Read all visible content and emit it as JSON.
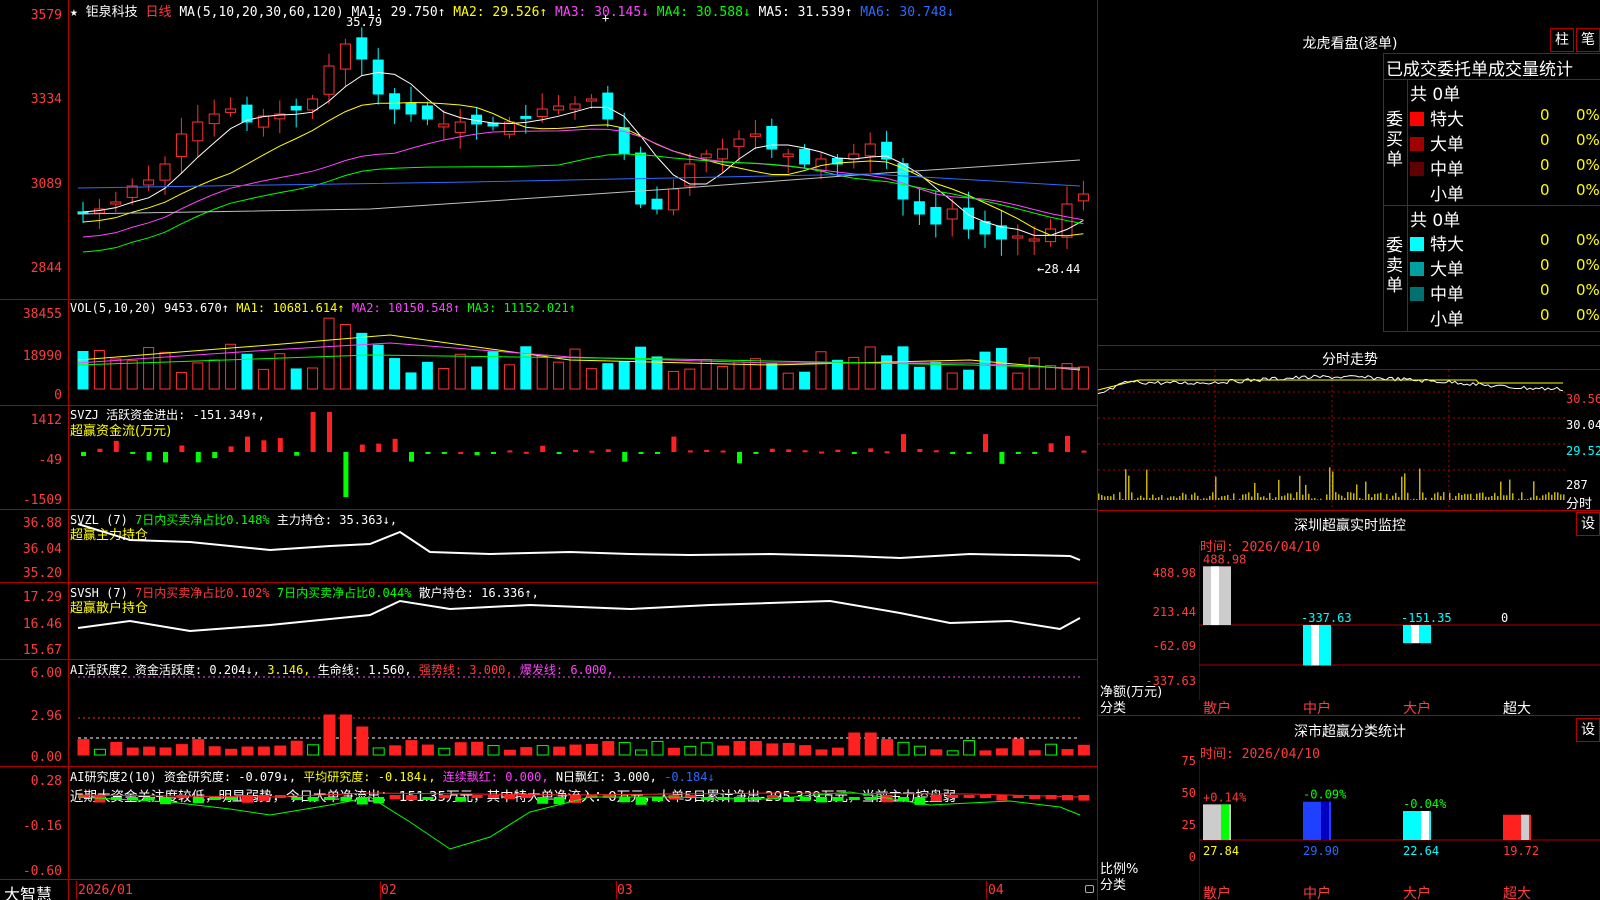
{
  "main": {
    "header": {
      "star": "★",
      "stock_name": "钜泉科技",
      "period": "日线",
      "ma_label": "MA(5,10,20,30,60,120)",
      "ma1": "MA1: 29.750↑",
      "ma2": "MA2: 29.526↑",
      "ma3": "MA3: 30.145↓",
      "ma4": "MA4: 30.588↓",
      "ma5": "MA5: 31.539↑",
      "ma6": "MA6: 30.748↓"
    },
    "yaxis": [
      "3579",
      "3334",
      "3089",
      "2844"
    ],
    "high_mark": "35.79",
    "low_mark": "←28.44",
    "colors": {
      "up": "#ff3232",
      "down": "#00ffff",
      "ma1": "#ffffff",
      "ma2": "#ffff00",
      "ma3": "#ff44ff",
      "ma4": "#00ff00",
      "ma5": "#c0c0c0",
      "ma6": "#2b6bff"
    }
  },
  "vol": {
    "label": "VOL(5,10,20)",
    "value": "9453.670↑",
    "ma1": "MA1: 10681.614↑",
    "ma2": "MA2: 10150.548↑",
    "ma3": "MA3: 11152.021↑",
    "yaxis": [
      "38455",
      "18990",
      "0"
    ]
  },
  "svzj": {
    "label": "SVZJ  活跃资金进出: -151.349↑,",
    "sub": "超赢资金流(万元)",
    "yaxis": [
      "1412",
      "-49",
      "-1509"
    ]
  },
  "svzl": {
    "label": "SVZL (7)",
    "a": "7日内买卖净占比0.148%",
    "b": "主力持仓: 35.363↓,",
    "sub": "超赢主力持仓",
    "yaxis": [
      "36.88",
      "36.04",
      "35.20"
    ]
  },
  "svsh": {
    "label": "SVSH (7)",
    "a": "7日内买卖净占比0.102%",
    "b": "7日内买卖净占比0.044%",
    "c": "散户持仓: 16.336↑,",
    "sub": "超赢散户持仓",
    "yaxis": [
      "17.29",
      "16.46",
      "15.67"
    ]
  },
  "ai1": {
    "label": "AI活跃度2",
    "a": "资金活跃度: 0.204↓,",
    "b": "3.146,",
    "c": "生命线: 1.560,",
    "d": "强势线: 3.000,",
    "e": "爆发线: 6.000,",
    "yaxis": [
      "6.00",
      "2.96",
      "0.00"
    ]
  },
  "ai2": {
    "label": "AI研究度2(10)",
    "a": "资金研究度: -0.079↓,",
    "b": "平均研究度: -0.184↓,",
    "c": "连续飘红: 0.000,",
    "d": "N日飘红: 3.000,",
    "e": "-0.184↓",
    "comment": "近期大资金关注度较低，明显弱势，今日大单净流出：-151.35万元，其中特大单净流入：0万元，大单5日累计净出-295.339万元，当前主力控盘弱",
    "yaxis": [
      "0.28",
      "-0.16",
      "-0.60"
    ]
  },
  "footer": {
    "brand": "大智慧",
    "dates": [
      "2026/01",
      "02",
      "03",
      "04"
    ]
  },
  "right": {
    "lhb": {
      "title": "龙虎看盘(逐单)",
      "btn_bar": "柱",
      "btn_pen": "笔",
      "subtitle": "已成交委托单成交量统计",
      "buy_side": "委买单",
      "sell_side": "委卖单",
      "buy_total": "共 0单",
      "sell_total": "共 0单",
      "rows": [
        "特大",
        "大单",
        "中单",
        "小单"
      ],
      "count": "0",
      "pct": "0%"
    },
    "intraday": {
      "title": "分时走势",
      "labels": [
        "30.56",
        "30.04",
        "29.52",
        "287",
        "分时"
      ]
    },
    "monitor": {
      "title": "深圳超赢实时监控",
      "btn": "设",
      "time": "时间: 2026/04/10",
      "yaxis": [
        "488.98",
        "213.44",
        "-62.09",
        "-337.63"
      ],
      "values": [
        "488.98",
        "-337.63",
        "-151.35",
        "0"
      ],
      "unit": "净额(万元)",
      "cat_label": "分类",
      "categories": [
        "散户",
        "中户",
        "大户",
        "超大"
      ]
    },
    "classify": {
      "title": "深市超赢分类统计",
      "btn": "设",
      "time": "时间: 2026/04/10",
      "yaxis": [
        "75",
        "50",
        "25",
        "0"
      ],
      "top_values": [
        "+0.14%",
        "-0.09%",
        "-0.04%"
      ],
      "bottom_values": [
        "27.84",
        "29.90",
        "22.64",
        "19.72"
      ],
      "unit": "比例%",
      "cat_label": "分类",
      "categories": [
        "散户",
        "中户",
        "大户",
        "超大"
      ]
    }
  }
}
